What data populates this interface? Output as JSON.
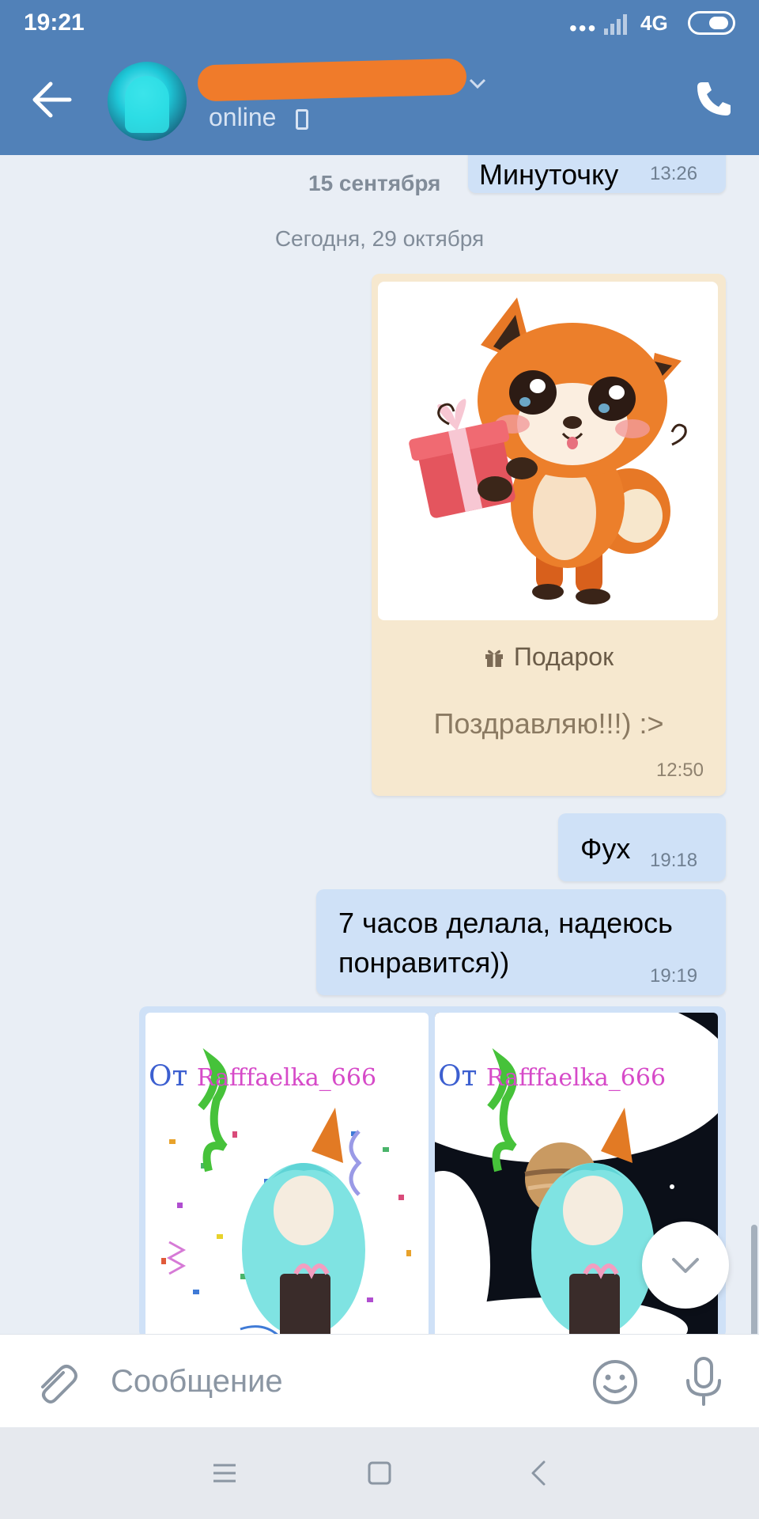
{
  "status_bar": {
    "time": "19:21",
    "dots": "•••",
    "network": "4G"
  },
  "header": {
    "status": "online"
  },
  "chat": {
    "earlier_message": {
      "text": "Минуточку",
      "time": "13:26",
      "date": "15 сентября"
    },
    "date_separator": "Сегодня, 29 октября",
    "gift": {
      "label": "Подарок",
      "text": "Поздравляю!!!) :>",
      "time": "12:50"
    },
    "messages": [
      {
        "text": "Фух",
        "time": "19:18"
      },
      {
        "line1": "7 часов делала, надеюсь",
        "line2": "понравится))",
        "time": "19:19"
      }
    ],
    "photos": {
      "signature_prefix": "От",
      "signature_name": "Rafffaelka_666"
    }
  },
  "composer": {
    "placeholder": "Сообщение"
  },
  "colors": {
    "header": "#5181b8",
    "outgoing_bubble": "#cfe1f7",
    "gift_bubble": "#f6e8cf",
    "background": "#e9eef5"
  }
}
